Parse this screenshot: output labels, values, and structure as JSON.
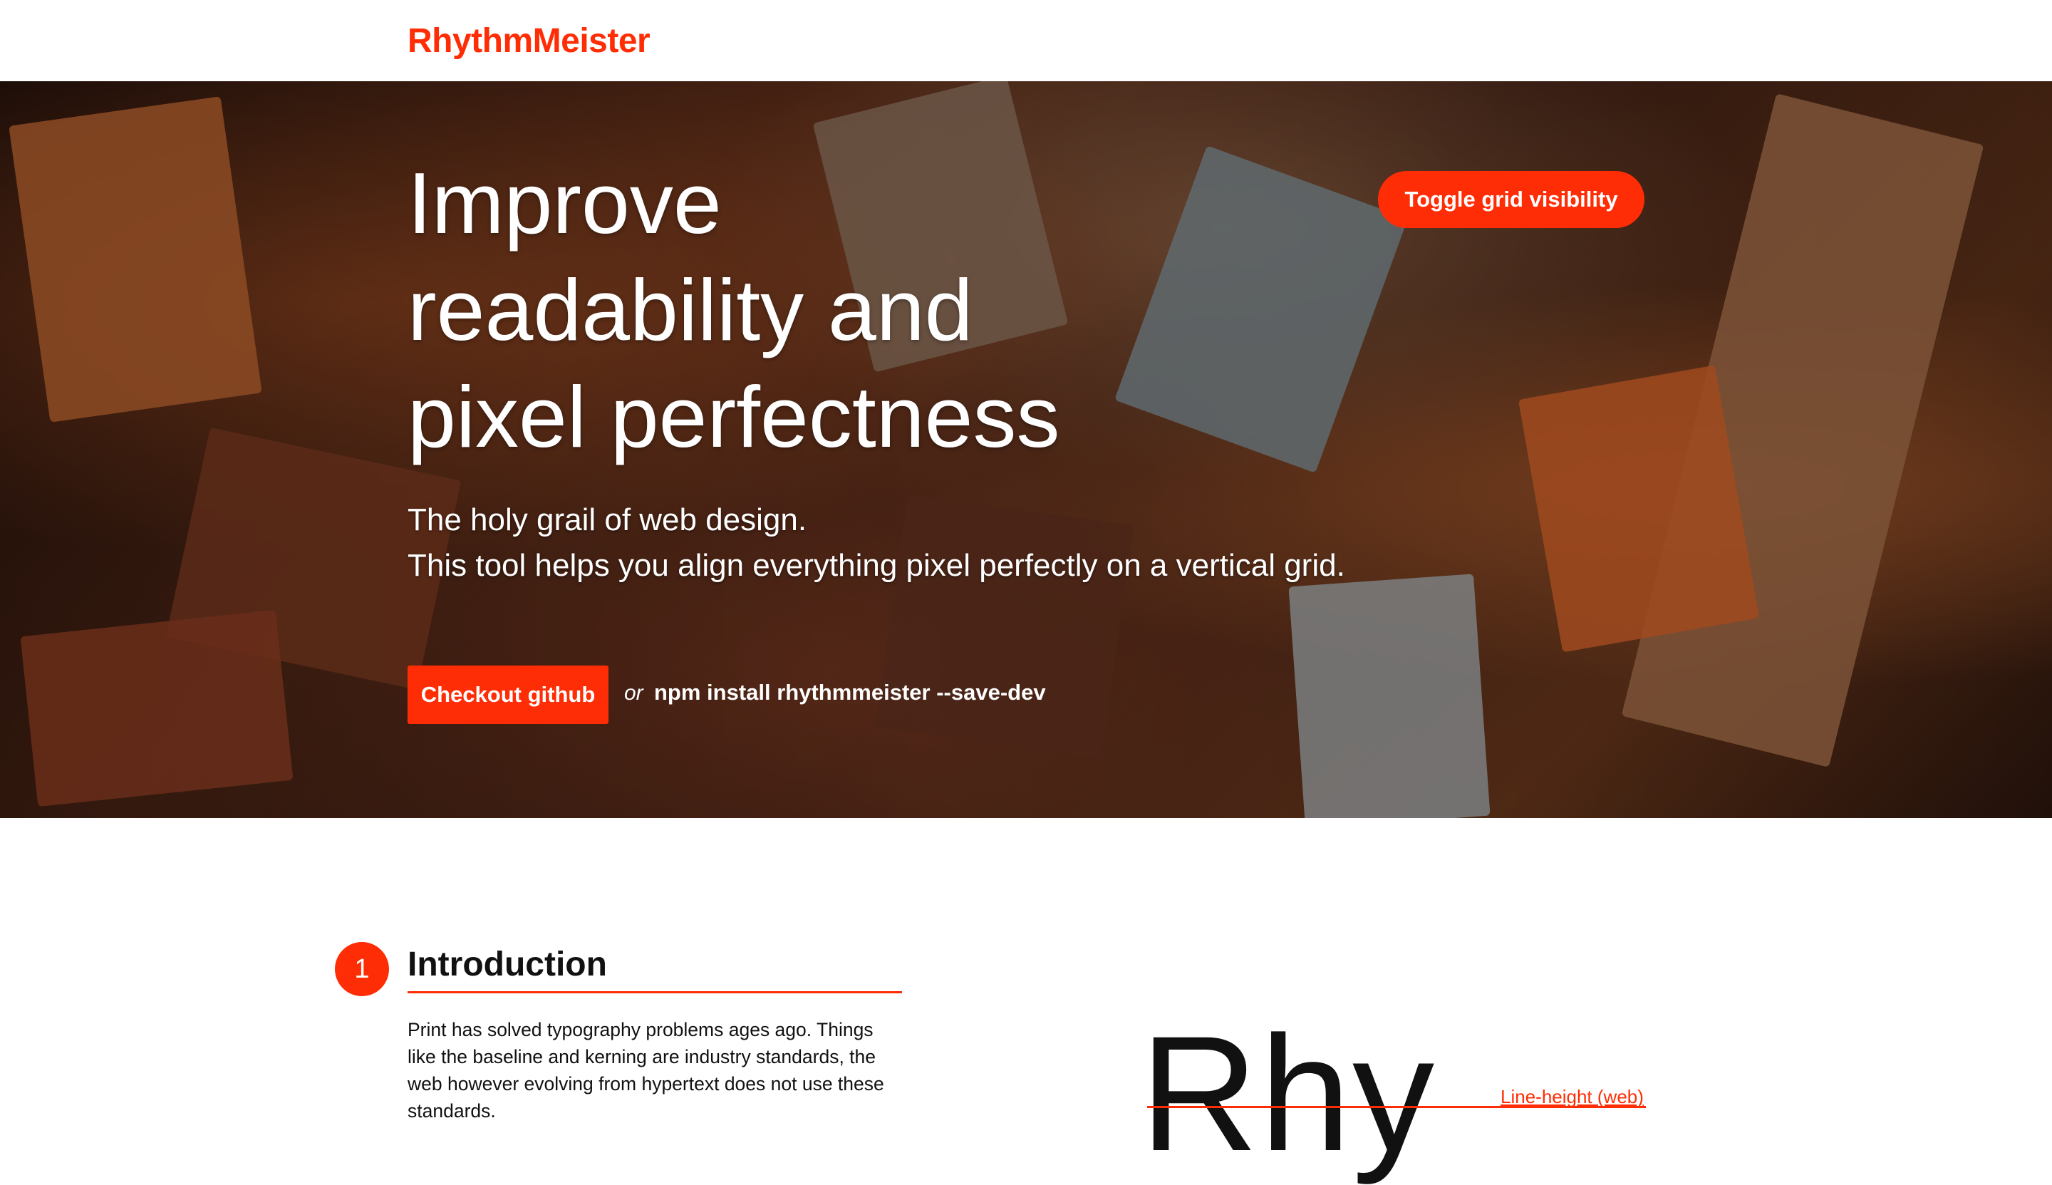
{
  "header": {
    "logo": "RhythmMeister"
  },
  "hero": {
    "title_lines": [
      "Improve",
      "readability and",
      "pixel perfectness"
    ],
    "subtitle_lines": [
      "The holy grail of web design.",
      "This tool helps you align everything pixel perfectly on a vertical grid."
    ],
    "github_button": "Checkout github",
    "or_text": "or",
    "npm_command": "npm install rhythmmeister --save-dev",
    "toggle_button": "Toggle grid visibility"
  },
  "intro": {
    "step_number": "1",
    "heading": "Introduction",
    "text": "Print has solved typography problems ages ago. Things like the baseline and kerning are industry standards, the web however evolving from hypertext does not use these standards."
  },
  "demo": {
    "sample_text": "Rhy",
    "line_label": "Line-height (web)"
  },
  "colors": {
    "accent": "#ff2d05"
  }
}
